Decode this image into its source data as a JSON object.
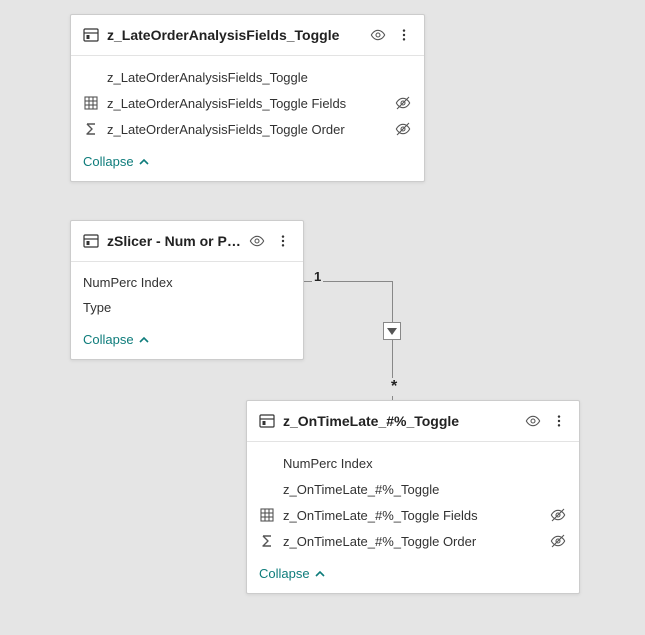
{
  "collapse_label": "Collapse",
  "relationship": {
    "from_cardinality": "1",
    "to_cardinality": "*"
  },
  "cards": {
    "c1": {
      "title": "z_LateOrderAnalysisFields_Toggle",
      "fields": [
        {
          "name": "z_LateOrderAnalysisFields_Toggle",
          "icon": "none",
          "hidden": false
        },
        {
          "name": "z_LateOrderAnalysisFields_Toggle Fields",
          "icon": "grid",
          "hidden": true
        },
        {
          "name": "z_LateOrderAnalysisFields_Toggle Order",
          "icon": "sigma",
          "hidden": true
        }
      ]
    },
    "c2": {
      "title": "zSlicer - Num or Percent",
      "fields": [
        {
          "name": "NumPerc Index",
          "icon": "none",
          "hidden": false
        },
        {
          "name": "Type",
          "icon": "none",
          "hidden": false
        }
      ]
    },
    "c3": {
      "title": "z_OnTimeLate_#%_Toggle",
      "fields": [
        {
          "name": "NumPerc Index",
          "icon": "none",
          "hidden": false
        },
        {
          "name": "z_OnTimeLate_#%_Toggle",
          "icon": "none",
          "hidden": false
        },
        {
          "name": "z_OnTimeLate_#%_Toggle Fields",
          "icon": "grid",
          "hidden": true
        },
        {
          "name": "z_OnTimeLate_#%_Toggle Order",
          "icon": "sigma",
          "hidden": true
        }
      ]
    }
  }
}
